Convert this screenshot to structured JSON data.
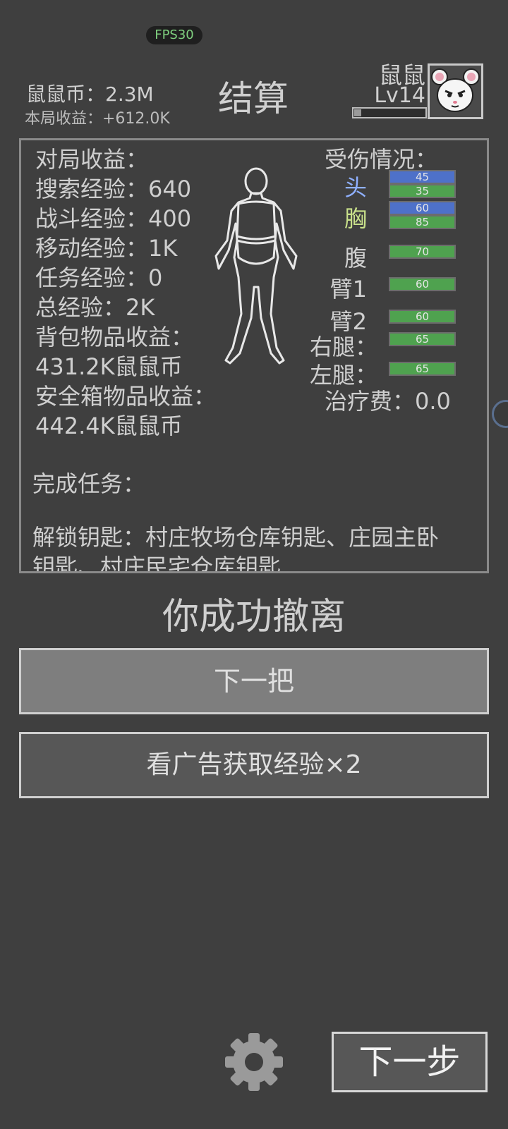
{
  "fps_label": "FPS30",
  "header": {
    "coins": "鼠鼠币：2.3M",
    "round_income": "本局收益：+612.0K",
    "title": "结算",
    "player_name": "鼠鼠",
    "player_level": "Lv14",
    "xp_progress": 0.1
  },
  "summary": {
    "income_title": "对局收益：",
    "lines": [
      "搜索经验：640",
      "战斗经验：400",
      "移动经验：1K",
      "任务经验：0",
      "总经验：2K",
      "背包物品收益：",
      "431.2K鼠鼠币",
      "安全箱物品收益：",
      "442.4K鼠鼠币"
    ],
    "tasks_label": "完成任务：",
    "keys_line1": "解锁钥匙：村庄牧场仓库钥匙、庄园主卧",
    "keys_line2": "钥匙、村庄民宅仓库钥匙"
  },
  "injury": {
    "title": "受伤情况：",
    "parts": [
      {
        "label": "头",
        "color": "#8fb0ff",
        "bars": [
          {
            "value": "45",
            "type": "blue"
          },
          {
            "value": "35",
            "type": "green"
          }
        ]
      },
      {
        "label": "胸",
        "color": "#c8e08a",
        "bars": [
          {
            "value": "60",
            "type": "blue"
          },
          {
            "value": "85",
            "type": "green"
          }
        ]
      },
      {
        "label": "腹",
        "color": "#d0d0d0",
        "bars": [
          {
            "value": "70",
            "type": "green"
          }
        ]
      },
      {
        "label": "臂1",
        "color": "#d0d0d0",
        "bars": [
          {
            "value": "60",
            "type": "green"
          }
        ]
      },
      {
        "label": "臂2",
        "color": "#d0d0d0",
        "bars": [
          {
            "value": "60",
            "type": "green"
          }
        ]
      },
      {
        "label": "右腿：",
        "color": "#d0d0d0",
        "bars": [
          {
            "value": "65",
            "type": "green"
          }
        ]
      },
      {
        "label": "左腿：",
        "color": "#d0d0d0",
        "bars": [
          {
            "value": "65",
            "type": "green"
          }
        ]
      }
    ],
    "healing_fee": "治疗费：0.0"
  },
  "result_text": "你成功撤离",
  "buttons": {
    "next_round": "下一把",
    "watch_ad": "看广告获取经验×2",
    "next_step": "下一步"
  }
}
